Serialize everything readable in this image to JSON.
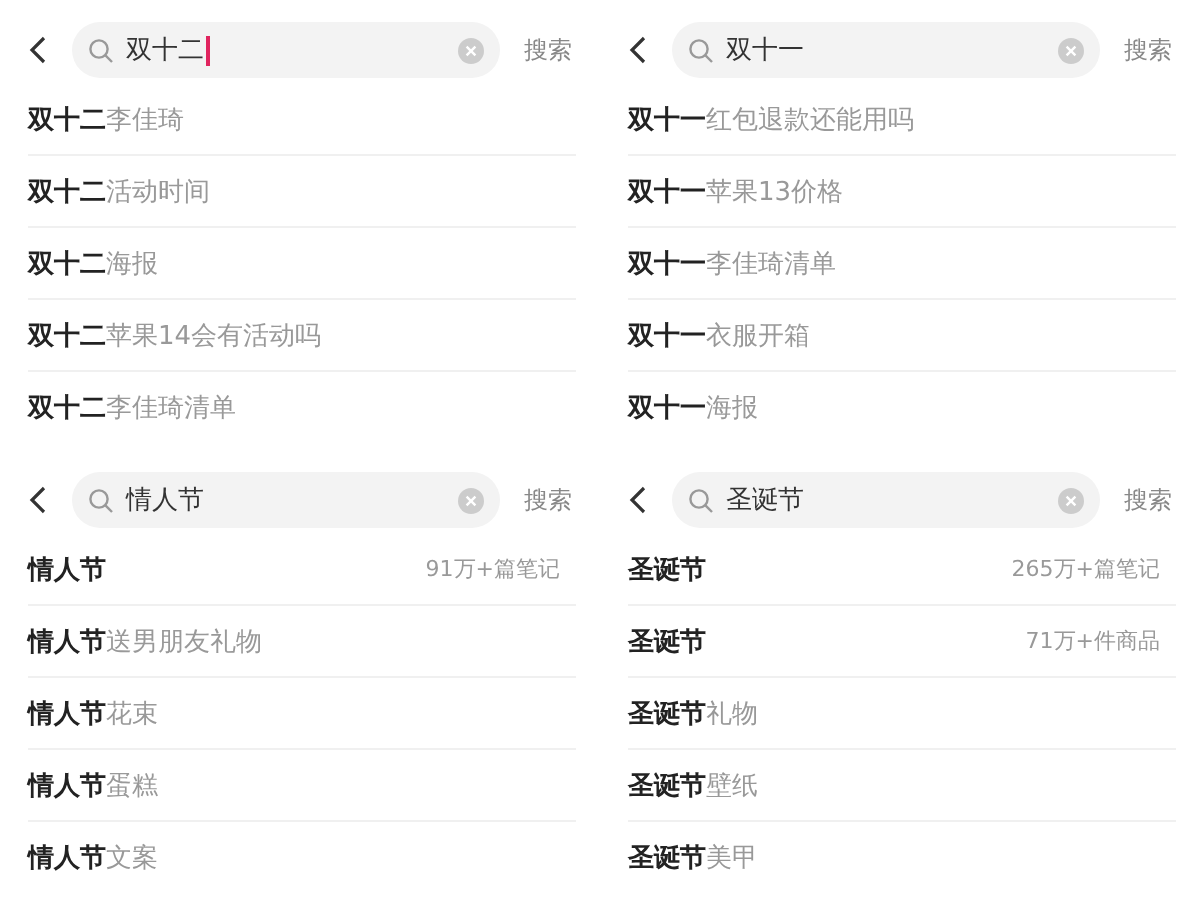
{
  "panels": [
    {
      "search": {
        "value": "双十二",
        "cursor": true
      },
      "search_button": "搜索",
      "suggestions": [
        {
          "text": "**双十二**李佳琦"
        },
        {
          "text": "**双十二**活动时间"
        },
        {
          "text": "**双十二**海报"
        },
        {
          "text": "**双十二**苹果14会有活动吗"
        },
        {
          "text": "**双十二**李佳琦清单"
        }
      ]
    },
    {
      "search": {
        "value": "双十一",
        "cursor": false
      },
      "search_button": "搜索",
      "suggestions": [
        {
          "text": "**双十一**红包退款还能用吗"
        },
        {
          "text": "**双十一**苹果13价格"
        },
        {
          "text": "**双十一**李佳琦清单"
        },
        {
          "text": "**双十一**衣服开箱"
        },
        {
          "text": "**双十一**海报"
        }
      ]
    },
    {
      "search": {
        "value": "情人节",
        "cursor": false
      },
      "search_button": "搜索",
      "suggestions": [
        {
          "text": "**情人节**",
          "count": "91万+篇笔记"
        },
        {
          "text": "**情人节**送男朋友礼物"
        },
        {
          "text": "**情人节**花束"
        },
        {
          "text": "**情人节**蛋糕"
        },
        {
          "text": "**情人节**文案"
        }
      ]
    },
    {
      "search": {
        "value": "圣诞节",
        "cursor": false
      },
      "search_button": "搜索",
      "suggestions": [
        {
          "text": "**圣诞节**",
          "count": "265万+篇笔记"
        },
        {
          "text": "**圣诞节**",
          "count": "71万+件商品"
        },
        {
          "text": "**圣诞节**礼物"
        },
        {
          "text": "**圣诞节**壁纸"
        },
        {
          "text": "**圣诞节**美甲"
        }
      ]
    }
  ]
}
